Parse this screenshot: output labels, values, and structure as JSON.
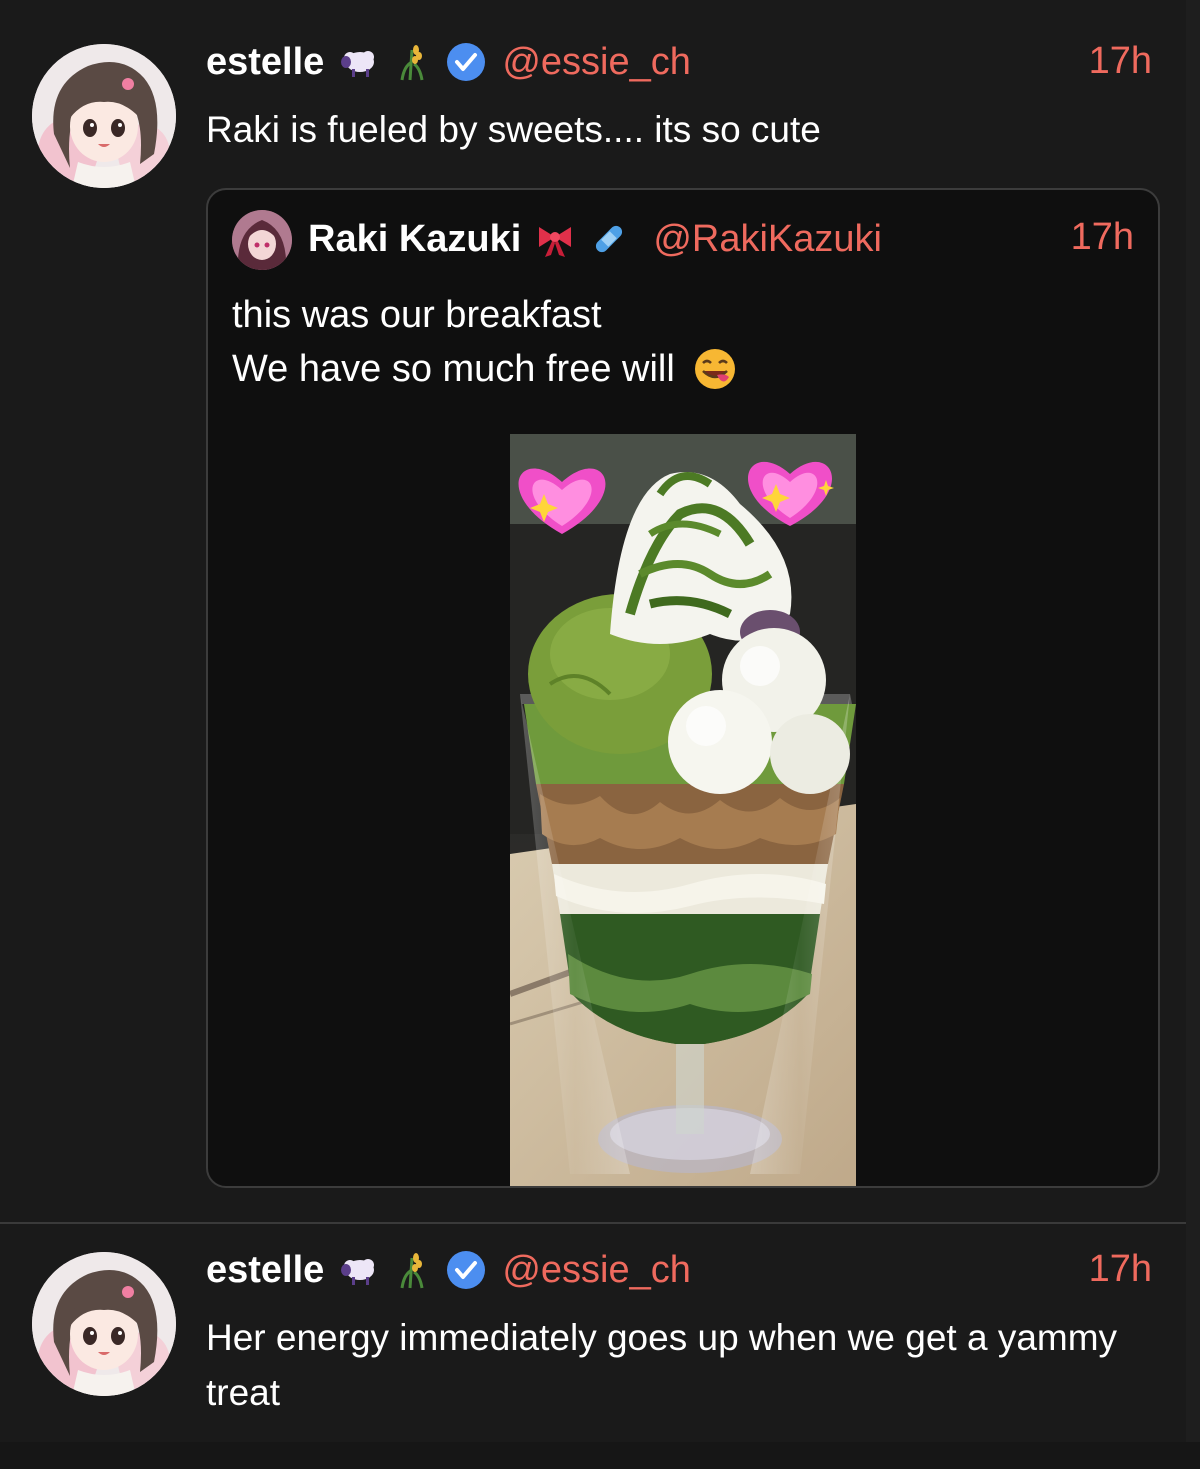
{
  "posts": [
    {
      "author": "estelle",
      "handle": "@essie_ch",
      "time": "17h",
      "text": "Raki is fueled by sweets.... its so cute",
      "badges": [
        "sheep-emoji",
        "rice-emoji",
        "verified-badge"
      ],
      "quote": {
        "author": "Raki Kazuki",
        "handle": "@RakiKazuki",
        "time": "17h",
        "badges": [
          "ribbon-emoji",
          "bandage-emoji"
        ],
        "line1": "this was our breakfast",
        "line2": "We have so much free will",
        "line2_emoji": "face-savoring-food-emoji",
        "media": "matcha-parfait-photo"
      }
    },
    {
      "author": "estelle",
      "handle": "@essie_ch",
      "time": "17h",
      "text": "Her energy immediately goes up when we get a yammy treat",
      "badges": [
        "sheep-emoji",
        "rice-emoji",
        "verified-badge"
      ]
    }
  ],
  "colors": {
    "background": "#1a1a1a",
    "accent": "#ef6a5e",
    "verified": "#3b82f6",
    "text": "#ffffff"
  }
}
